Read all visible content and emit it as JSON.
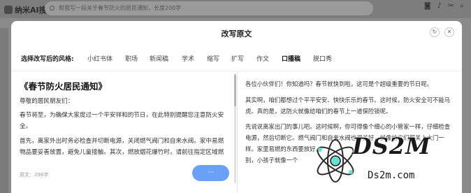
{
  "background": {
    "brand": "纳米AI搜索",
    "search_text": "帮我写一段关于春节防火的居民通知，长度200字",
    "icons": [
      "camera-icon",
      "microphone-icon",
      "scissors-icon",
      "search-icon"
    ]
  },
  "dialog": {
    "title": "改写原文",
    "style_label": "选择改写后的风格:",
    "styles": [
      {
        "label": "小红书体"
      },
      {
        "label": "职场"
      },
      {
        "label": "新闻稿"
      },
      {
        "label": "学术"
      },
      {
        "label": "缩写"
      },
      {
        "label": "扩写"
      },
      {
        "label": "作文"
      },
      {
        "label": "口播稿",
        "active": true
      },
      {
        "label": "脱口秀"
      }
    ],
    "accent_color": "#6aa1f7"
  },
  "left_pane": {
    "doc_title": "《春节防火居民通知》",
    "greeting": "尊敬的居民朋友们：",
    "para1": "春节将至，为确保大家度过一个平安祥和的节日，在此特别提醒您注意防火安全。",
    "para2": "首先，离家外出时务必检查并切断电源，关闭燃气阀门和自来水阀。家中易燃物品要妥善放置，避免儿童接触。其次，燃放烟花爆竹时，请前往指定区域燃放。",
    "word_count": "原文：298字",
    "generate_label": "···"
  },
  "right_pane": {
    "para1": "各位小伙伴们！你知道吗？春节就快到啦，这可是个超级重要的节日呢。",
    "para2": "其实啊，咱们都想过个平平安安、快快乐乐的春节。这时候，防火安全可不能马虎。真的是，这防火就像给咱们的春节上一道保险锁呢。",
    "para3": "先说说离家出门的事儿吧。这时候啊，你可得像个细心的小管家一样，仔细检查电源，然后切断它。燃气阀门和自来水阀也得关好，就像给它们都关上大门一样。家里易燃的东西要放好，",
    "para4": "别，小孩子就像一个"
  },
  "watermark": {
    "text": "DS2M",
    "url": "Ds2m.com"
  }
}
